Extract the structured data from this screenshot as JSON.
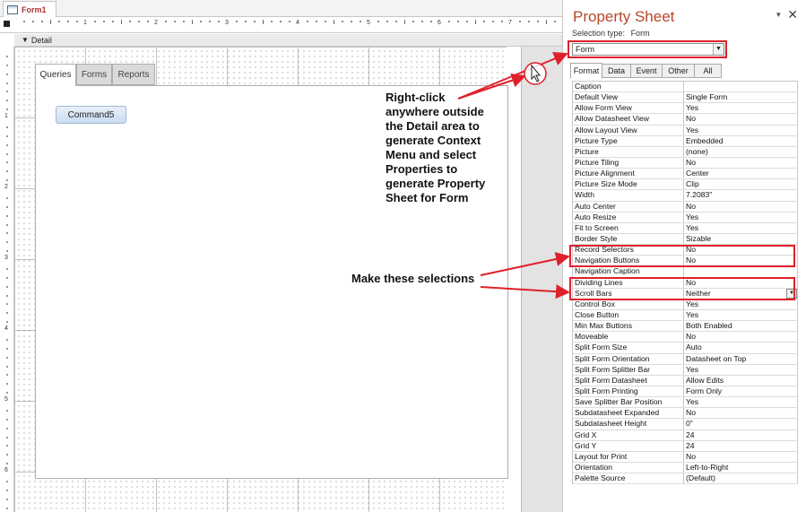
{
  "document": {
    "tab_label": "Form1",
    "section_label": "Detail"
  },
  "ruler": {
    "top_numbers": [
      "1",
      "2",
      "3",
      "4",
      "5",
      "6",
      "7"
    ],
    "left_numbers": [
      "1",
      "2",
      "3",
      "4",
      "5",
      "6"
    ]
  },
  "tab_control": {
    "tabs": [
      "Queries",
      "Forms",
      "Reports"
    ],
    "active_tab": "Queries",
    "button_label": "Command5"
  },
  "annotations": {
    "right_click_note": [
      "Right-click",
      "anywhere outside",
      "the Detail area to",
      "generate Context",
      "Menu and select",
      "Properties to",
      "generate Property",
      "Sheet for Form"
    ],
    "selection_note": "Make these selections",
    "arrow_color": "#e0202a"
  },
  "property_sheet": {
    "title": "Property Sheet",
    "selection_type_label": "Selection type:",
    "selection_type_value": "Form",
    "selected_object": "Form",
    "tabs": [
      "Format",
      "Data",
      "Event",
      "Other",
      "All"
    ],
    "active_tab": "Format",
    "title_color": "#b7472a",
    "properties": [
      {
        "name": "Caption",
        "value": ""
      },
      {
        "name": "Default View",
        "value": "Single Form"
      },
      {
        "name": "Allow Form View",
        "value": "Yes"
      },
      {
        "name": "Allow Datasheet View",
        "value": "No"
      },
      {
        "name": "Allow Layout View",
        "value": "Yes"
      },
      {
        "name": "Picture Type",
        "value": "Embedded"
      },
      {
        "name": "Picture",
        "value": "(none)"
      },
      {
        "name": "Picture Tiling",
        "value": "No"
      },
      {
        "name": "Picture Alignment",
        "value": "Center"
      },
      {
        "name": "Picture Size Mode",
        "value": "Clip"
      },
      {
        "name": "Width",
        "value": "7.2083\""
      },
      {
        "name": "Auto Center",
        "value": "No"
      },
      {
        "name": "Auto Resize",
        "value": "Yes"
      },
      {
        "name": "Fit to Screen",
        "value": "Yes"
      },
      {
        "name": "Border Style",
        "value": "Sizable"
      },
      {
        "name": "Record Selectors",
        "value": "No"
      },
      {
        "name": "Navigation Buttons",
        "value": "No"
      },
      {
        "name": "Navigation Caption",
        "value": ""
      },
      {
        "name": "Dividing Lines",
        "value": "No"
      },
      {
        "name": "Scroll Bars",
        "value": "Neither"
      },
      {
        "name": "Control Box",
        "value": "Yes"
      },
      {
        "name": "Close Button",
        "value": "Yes"
      },
      {
        "name": "Min Max Buttons",
        "value": "Both Enabled"
      },
      {
        "name": "Moveable",
        "value": "No"
      },
      {
        "name": "Split Form Size",
        "value": "Auto"
      },
      {
        "name": "Split Form Orientation",
        "value": "Datasheet on Top"
      },
      {
        "name": "Split Form Splitter Bar",
        "value": "Yes"
      },
      {
        "name": "Split Form Datasheet",
        "value": "Allow Edits"
      },
      {
        "name": "Split Form Printing",
        "value": "Form Only"
      },
      {
        "name": "Save Splitter Bar Position",
        "value": "Yes"
      },
      {
        "name": "Subdatasheet Expanded",
        "value": "No"
      },
      {
        "name": "Subdatasheet Height",
        "value": "0\""
      },
      {
        "name": "Grid X",
        "value": "24"
      },
      {
        "name": "Grid Y",
        "value": "24"
      },
      {
        "name": "Layout for Print",
        "value": "No"
      },
      {
        "name": "Orientation",
        "value": "Left-to-Right"
      },
      {
        "name": "Palette Source",
        "value": "(Default)"
      }
    ]
  }
}
